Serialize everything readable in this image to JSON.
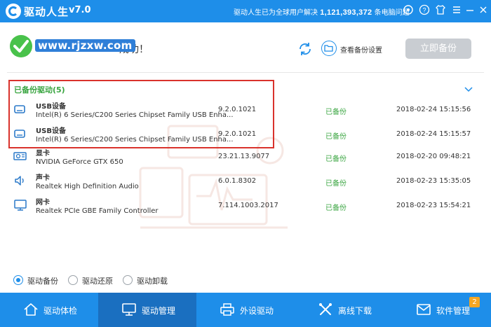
{
  "titlebar": {
    "app_title": "驱动人生",
    "version": "v7.0",
    "promo_prefix": "驱动人生已为全球用户解决",
    "promo_count": "1,121,393,372",
    "promo_suffix": "条电脑问题",
    "icons": [
      "settings-icon",
      "help-icon",
      "shirt-icon",
      "menu-icon",
      "minimize-icon",
      "close-icon"
    ]
  },
  "header": {
    "watermark": "www.rjzxw.com",
    "success_text": "成功！",
    "view_settings_label": "查看备份设置",
    "backup_now_label": "立即备份"
  },
  "section": {
    "title": "已备份驱动(5)"
  },
  "drivers": [
    {
      "category": "USB设备",
      "name": "Intel(R) 6 Series/C200 Series Chipset Family USB Enha...",
      "version": "9.2.0.1021",
      "status": "已备份",
      "date": "2018-02-24 15:15:56",
      "icon": "usb-drive-icon"
    },
    {
      "category": "USB设备",
      "name": "Intel(R) 6 Series/C200 Series Chipset Family USB Enha...",
      "version": "9.2.0.1021",
      "status": "已备份",
      "date": "2018-02-24 15:15:57",
      "icon": "usb-drive-icon"
    },
    {
      "category": "显卡",
      "name": "NVIDIA GeForce GTX 650",
      "version": "23.21.13.9077",
      "status": "已备份",
      "date": "2018-02-20 09:48:21",
      "icon": "display-card-icon"
    },
    {
      "category": "声卡",
      "name": "Realtek High Definition Audio",
      "version": "6.0.1.8302",
      "status": "已备份",
      "date": "2018-02-23 15:35:05",
      "icon": "speaker-icon"
    },
    {
      "category": "网卡",
      "name": "Realtek PCIe GBE Family Controller",
      "version": "7.114.1003.2017",
      "status": "已备份",
      "date": "2018-02-23 15:54:21",
      "icon": "network-card-icon"
    }
  ],
  "radio_options": [
    {
      "label": "驱动备份",
      "selected": true
    },
    {
      "label": "驱动还原",
      "selected": false
    },
    {
      "label": "驱动卸载",
      "selected": false
    }
  ],
  "bottom_nav": [
    {
      "label": "驱动体检",
      "icon": "home-icon",
      "active": false
    },
    {
      "label": "驱动管理",
      "icon": "monitor-icon",
      "active": true
    },
    {
      "label": "外设驱动",
      "icon": "printer-icon",
      "active": false
    },
    {
      "label": "离线下载",
      "icon": "tools-icon",
      "active": false
    },
    {
      "label": "软件管理",
      "icon": "mail-box-icon",
      "active": false
    }
  ],
  "software_badge": "2",
  "colors": {
    "brand_blue": "#1e8ee9",
    "active_nav": "#1a6fc0",
    "success_green": "#3aa541",
    "highlight_red": "#d9322c",
    "disabled_button": "#c9cdd2",
    "badge_orange": "#f5a623"
  }
}
